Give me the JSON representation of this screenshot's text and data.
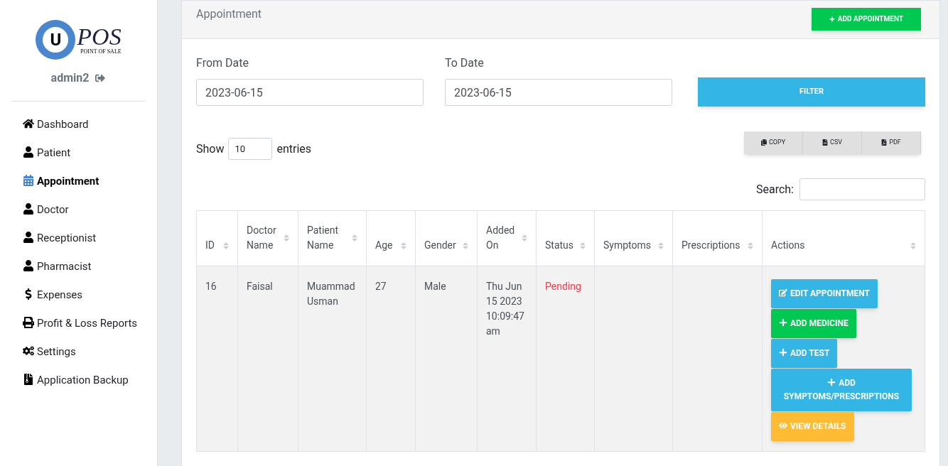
{
  "logo": {
    "mark": "U",
    "text": "POS",
    "tagline": "POINT OF SALE"
  },
  "user": {
    "name": "admin2"
  },
  "sidebar": {
    "items": [
      {
        "label": "Dashboard",
        "kind": "home",
        "selected": false
      },
      {
        "label": "Patient",
        "kind": "person",
        "selected": false
      },
      {
        "label": "Appointment",
        "kind": "calendar",
        "selected": true
      },
      {
        "label": "Doctor",
        "kind": "person",
        "selected": false
      },
      {
        "label": "Receptionist",
        "kind": "person",
        "selected": false
      },
      {
        "label": "Pharmacist",
        "kind": "person",
        "selected": false
      },
      {
        "label": "Expenses",
        "kind": "money",
        "selected": false
      },
      {
        "label": "Profit & Loss Reports",
        "kind": "report",
        "selected": false
      },
      {
        "label": "Settings",
        "kind": "settings",
        "selected": false
      },
      {
        "label": "Application Backup",
        "kind": "backup",
        "selected": false
      }
    ]
  },
  "header": {
    "title": "Appointment",
    "add_button": "ADD APPOINTMENT"
  },
  "filter": {
    "from_label": "From Date",
    "from_value": "2023-06-15",
    "to_label": "To Date",
    "to_value": "2023-06-15",
    "button": "FILTER"
  },
  "table_controls": {
    "show_label": "Show",
    "page_size": "10",
    "entries_label": "entries",
    "search_label": "Search:",
    "export_buttons": [
      {
        "label": "COPY",
        "kind": "copy"
      },
      {
        "label": "CSV",
        "kind": "csv"
      },
      {
        "label": "PDF",
        "kind": "pdf"
      }
    ]
  },
  "table": {
    "columns": [
      "ID",
      "Doctor Name",
      "Patient Name",
      "Age",
      "Gender",
      "Added On",
      "Status",
      "Symptoms",
      "Prescriptions",
      "Actions"
    ],
    "rows": [
      {
        "id": "16",
        "doctor": "Faisal",
        "patient": "Muammad Usman",
        "age": "27",
        "gender": "Male",
        "added_on": "Thu Jun 15 2023 10:09:47 am",
        "status": "Pending",
        "actions": [
          {
            "label": "EDIT APPOINTMENT",
            "kind": "edit"
          },
          {
            "label": "ADD MEDICINE",
            "kind": "medicine"
          },
          {
            "label": "ADD TEST",
            "kind": "test"
          },
          {
            "label": "ADD SYMPTOMS/PRESCRIPTIONS",
            "kind": "symptoms"
          },
          {
            "label": "VIEW DETAILS",
            "kind": "view"
          }
        ]
      }
    ]
  }
}
